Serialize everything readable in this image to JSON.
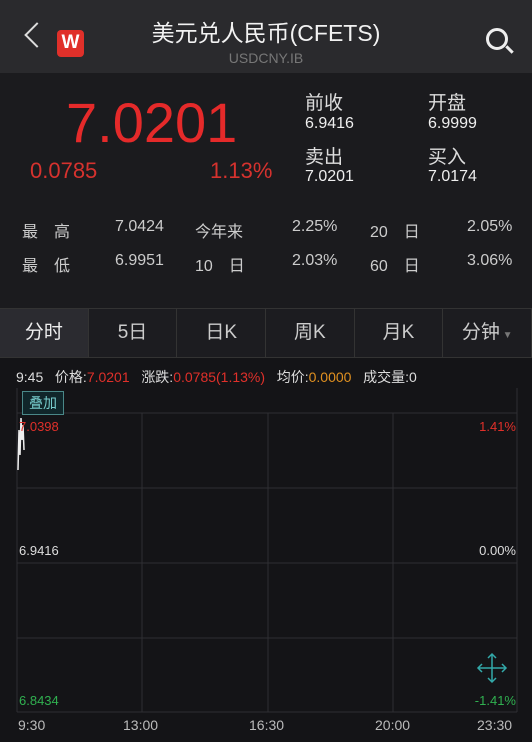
{
  "header": {
    "title": "美元兑人民币(CFETS)",
    "symbol": "USDCNY.IB",
    "logo": "W",
    "icons": [
      "back-icon",
      "search-icon"
    ]
  },
  "quote": {
    "price": "7.0201",
    "change": "0.0785",
    "change_pct": "1.13%",
    "prev_close_label": "前收",
    "prev_close": "6.9416",
    "open_label": "开盘",
    "open": "6.9999",
    "ask_label": "卖出",
    "ask": "7.0201",
    "bid_label": "买入",
    "bid": "7.0174"
  },
  "stats": {
    "high_label": "最　高",
    "high": "7.0424",
    "ytd_label": "今年来",
    "ytd": "2.25%",
    "d20_label": "20　日",
    "d20": "2.05%",
    "low_label": "最　低",
    "low": "6.9951",
    "d10_label": "10　日",
    "d10": "2.03%",
    "d60_label": "60　日",
    "d60": "3.06%"
  },
  "tabs": [
    "分时",
    "5日",
    "日K",
    "周K",
    "月K",
    "分钟"
  ],
  "info": {
    "time": "9:45",
    "price_label": "价格:",
    "price": "7.0201",
    "chg_label": "涨跌:",
    "chg": "0.0785(1.13%)",
    "avg_label": "均价:",
    "avg": "0.0000",
    "vol_label": "成交量:",
    "vol": "0"
  },
  "chart": {
    "overlay_label": "叠加",
    "y_top": "7.0398",
    "y_mid": "6.9416",
    "y_bot": "6.8434",
    "pct_top": "1.41%",
    "pct_mid": "0.00%",
    "pct_bot": "-1.41%",
    "x_labels": [
      "9:30",
      "13:00",
      "16:30",
      "20:00",
      "23:30"
    ],
    "colors": {
      "up": "#e0302a",
      "flat": "#dddddd",
      "down": "#30b050"
    }
  }
}
